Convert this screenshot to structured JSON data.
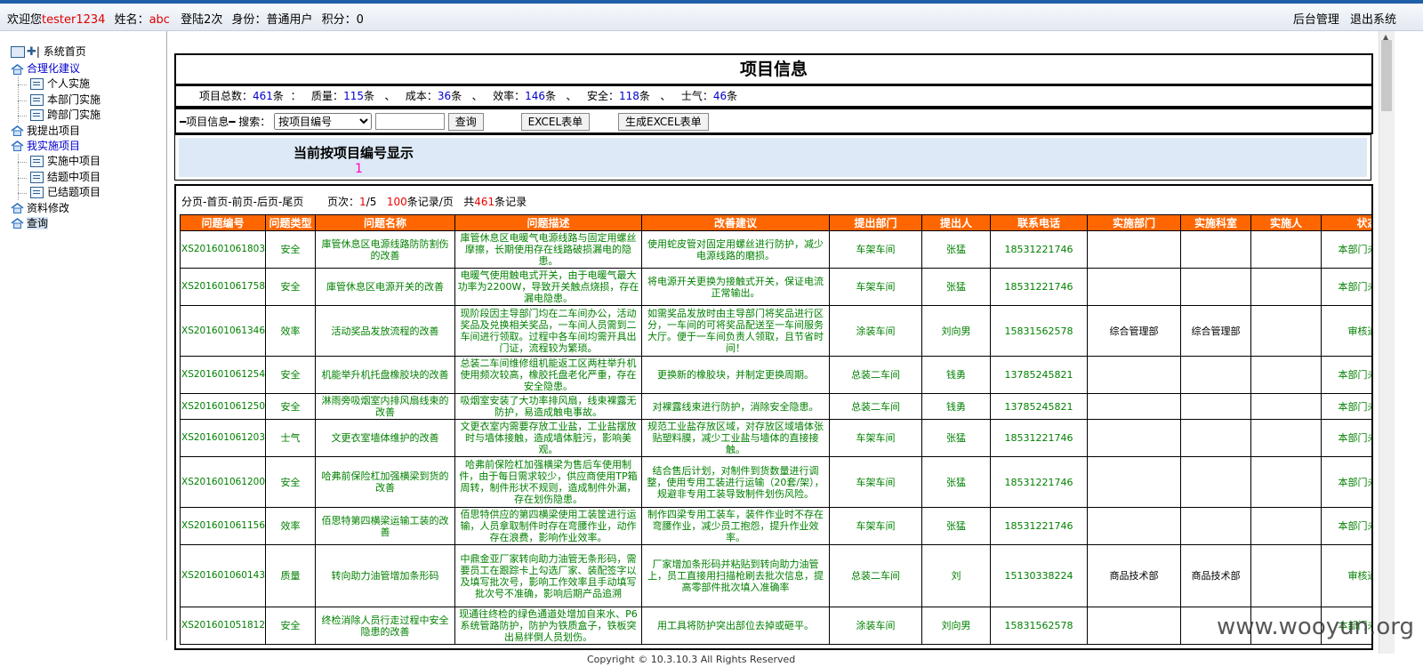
{
  "topbar": {
    "welcome_prefix": "欢迎您",
    "username": "tester1234",
    "name_label": "姓名：",
    "name_value": "abc",
    "login_count": "登陆2次",
    "identity": "身份：普通用户",
    "points": "积分：0",
    "admin_link": "后台管理",
    "logout_link": "退出系统"
  },
  "sidebar": {
    "root": "| 系统首页",
    "groups": [
      {
        "label": "合理化建议",
        "items": [
          "个人实施",
          "本部门实施",
          "跨部门实施"
        ]
      },
      {
        "label": "我提出项目",
        "items": []
      },
      {
        "label": "我实施项目",
        "items": [
          "实施中项目",
          "结题中项目",
          "已结题项目"
        ]
      },
      {
        "label": "资料修改",
        "items": []
      },
      {
        "label": "查询",
        "items": []
      }
    ]
  },
  "main": {
    "title": "项目信息",
    "stats": {
      "total_label": "项目总数：",
      "total": "461",
      "total_unit": "条",
      "sep": "：",
      "quality_label": "质量：",
      "quality": "115",
      "cost_label": "成本：",
      "cost": "36",
      "efficiency_label": "效率：",
      "efficiency": "146",
      "safety_label": "安全：",
      "safety": "118",
      "morale_label": "士气：",
      "morale": "46",
      "unit": "条",
      "comma": "、"
    },
    "search": {
      "label": "━项目信息━ 搜索：",
      "select_value": "按项目编号",
      "query_button": "查询",
      "excel_button": "EXCEL表单",
      "gen_excel_button": "生成EXCEL表单"
    },
    "mode": {
      "heading": "当前按项目编号显示",
      "value": "1"
    },
    "pager": {
      "nav": "分页-首页-前页-后页-尾页",
      "page_label": "页次：",
      "page_current": "1",
      "page_total": "/5",
      "per_page": "100",
      "per_page_label": "条记录/页",
      "total_label": "共",
      "total": "461",
      "total_unit": "条记录"
    },
    "table": {
      "headers": [
        "问题编号",
        "问题类型",
        "问题名称",
        "问题描述",
        "改善建议",
        "提出部门",
        "提出人",
        "联系电话",
        "实施部门",
        "实施科室",
        "实施人",
        "状态"
      ],
      "rows": [
        [
          "XS20160106180325",
          "安全",
          "庫管休息区电源线路防防割伤的改善",
          "庫管休息区电暖气电源线路与固定用螺丝摩擦，长期使用存在线路破损漏电的隐患。",
          "使用蛇皮管对固定用螺丝进行防护，减少电源线路的磨损。",
          "车架车间",
          "张猛",
          "18531221746",
          "",
          "",
          "",
          "本部门未审核"
        ],
        [
          "XS20160106175831",
          "安全",
          "庫管休息区电源开关的改善",
          "电暖气使用触电式开关，由于电暖气最大功率为2200W，导致开关触点烧损，存在漏电隐患。",
          "将电源开关更换为接触式开关，保证电流正常输出。",
          "车架车间",
          "张猛",
          "18531221746",
          "",
          "",
          "",
          "本部门未审核"
        ],
        [
          "XS20160106134641",
          "效率",
          "活动奖品发放流程的改善",
          "现阶段因主导部门均在二车间办公，活动奖品及兑换相关奖品，一车间人员需到二车间进行领取。过程中各车间均需开具出门证，流程较为繁琐。",
          "如需奖品发放时由主导部门将奖品进行区分，一车间的可将奖品配送至一车间服务大厅。便于一车间负责人领取，且节省时间！",
          "涂装车间",
          "刘向男",
          "15831562578",
          "综合管理部",
          "综合管理部",
          "",
          "审核通过"
        ],
        [
          "XS20160106125439",
          "安全",
          "机能举升机托盘橡胶块的改善",
          "总装二车间维修组机能返工区两柱举升机使用频次较高，橡胶托盘老化严重，存在安全隐患。",
          "更换新的橡胶块，并制定更换周期。",
          "总装二车间",
          "钱勇",
          "13785245821",
          "",
          "",
          "",
          "本部门未审核"
        ],
        [
          "XS20160106125033",
          "安全",
          "淋雨旁吸烟室内排风扇线束的改善",
          "吸烟室安装了大功率排风扇，线束裸露无防护，易造成触电事故。",
          "对裸露线束进行防护，消除安全隐患。",
          "总装二车间",
          "钱勇",
          "13785245821",
          "",
          "",
          "",
          "本部门未审核"
        ],
        [
          "XS20160106120303",
          "士气",
          "文更衣室墙体维护的改善",
          "文更衣室内需要存放工业盐，工业盐摆放时与墙体接触，造成墙体脏污，影响美观。",
          "规范工业盐存放区域，对存放区域墙体张贴塑料膜，减少工业盐与墙体的直接接触。",
          "车架车间",
          "张猛",
          "18531221746",
          "",
          "",
          "",
          "本部门未审核"
        ],
        [
          "XS20160106120033",
          "安全",
          "哈弗前保险杠加强横梁到货的改善",
          "哈弗前保险杠加强横梁为售后车使用制件，由于每日需求较少，供应商使用TP箱周转，制件形状不规则，造成制件外漏，存在划伤隐患。",
          "结合售后计划，对制件到货数量进行调整，使用专用工装进行运输（20套/架），规避非专用工装导致制件划伤风险。",
          "车架车间",
          "张猛",
          "18531221746",
          "",
          "",
          "",
          "本部门未审核"
        ],
        [
          "XS20160106115621",
          "效率",
          "佰思特第四横梁运输工装的改善",
          "佰思特供应的第四横梁使用工装筐进行运输，人员拿取制件时存在弯腰作业，动作存在浪费，影响作业效率。",
          "制作四梁专用工装车，装件作业时不存在弯腰作业，减少员工抱怨，提升作业效率。",
          "车架车间",
          "张猛",
          "18531221746",
          "",
          "",
          "",
          "本部门未审核"
        ],
        [
          "XS20160106014336",
          "质量",
          "转向助力油管增加条形码",
          "中鼎金亚厂家转向助力油管无条形码，需要员工在跟踪卡上勾选厂家、装配签字以及填写批次号，影响工作效率且手动填写批次号不准确，影响后期产品追溯",
          "厂家增加条形码并粘贴到转向助力油管上，员工直接用扫描枪刷去批次信息，提高零部件批次填入准确率",
          "总装二车间",
          "刘",
          "15130338224",
          "商品技术部",
          "商品技术部",
          "",
          "审核通过"
        ],
        [
          "XS20160105181214",
          "安全",
          "终检消除人员行走过程中安全隐患的改善",
          "现通往终检的绿色通道处增加自来水、P6系统管路防护，防护为铁质盒子，铁板突出易绊倒人员划伤。",
          "用工具将防护突出部位去掉或砸平。",
          "涂装车间",
          "刘向男",
          "15831562578",
          "",
          "",
          "",
          "本部门未审核"
        ]
      ]
    }
  },
  "footer": "Copyright © 10.3.10.3 All Rights Reserved",
  "watermark": "www.wooyun.org"
}
